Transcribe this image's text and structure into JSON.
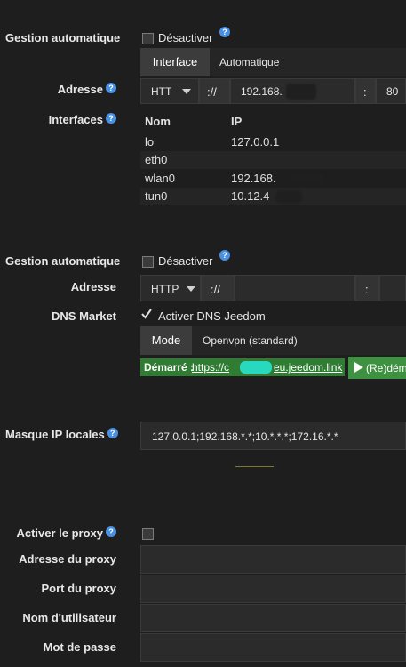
{
  "section1": {
    "gestion_label": "Gestion automatique",
    "gestion_checkbox_label": "Désactiver",
    "tabs": [
      "Interface",
      "Automatique"
    ],
    "adresse_label": "Adresse",
    "protocol": "HTT",
    "separator": "://",
    "ip_partial": "192.168.",
    "colon": ":",
    "port": "80",
    "interfaces_label": "Interfaces",
    "table": {
      "headers": [
        "Nom",
        "IP"
      ],
      "rows": [
        {
          "name": "lo",
          "ip": "127.0.0.1"
        },
        {
          "name": "eth0",
          "ip": ""
        },
        {
          "name": "wlan0",
          "ip": "192.168."
        },
        {
          "name": "tun0",
          "ip": "10.12.4"
        }
      ]
    }
  },
  "section2": {
    "gestion_label": "Gestion automatique",
    "gestion_checkbox_label": "Désactiver",
    "adresse_label": "Adresse",
    "protocol": "HTTP",
    "separator": "://",
    "colon": ":",
    "dns_label": "DNS Market",
    "dns_checkbox_label": "Activer DNS Jeedom",
    "mode_label": "Mode",
    "mode_value": "Openvpn (standard)",
    "status_prefix": "Démarré :",
    "status_link_start": "https://c",
    "status_link_end": "eu.jeedom.link",
    "restart_label": "(Re)dém"
  },
  "masque": {
    "label": "Masque IP locales",
    "value": "127.0.0.1;192.168.*.*;10.*.*.*;172.16.*.*"
  },
  "proxy": {
    "activer_label": "Activer le proxy",
    "adresse_label": "Adresse du proxy",
    "port_label": "Port du proxy",
    "user_label": "Nom d'utilisateur",
    "password_label": "Mot de passe"
  },
  "colors": {
    "background": "#1e1e1e",
    "accent_blue": "#4a90e2",
    "status_green": "#2e7d32",
    "olive_line": "#7a7a2a"
  }
}
